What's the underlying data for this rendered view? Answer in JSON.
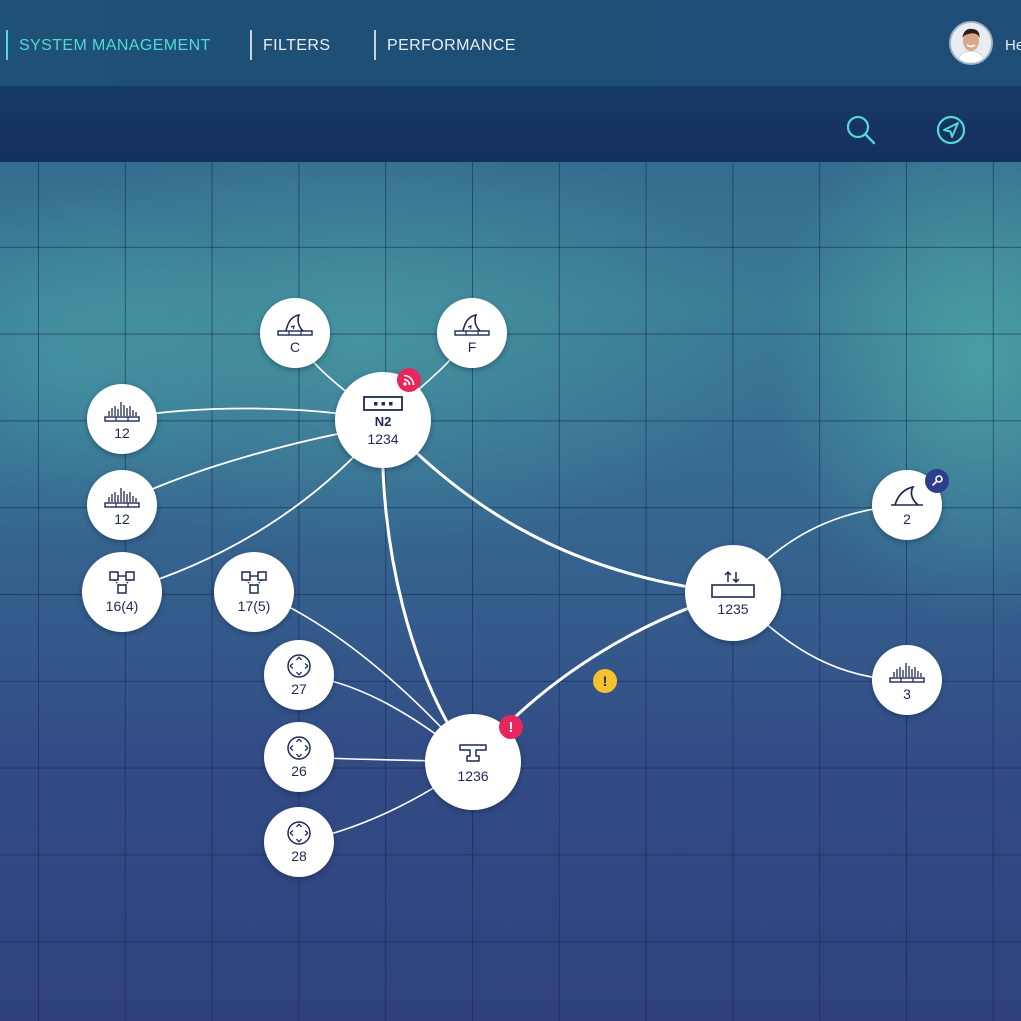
{
  "nav": {
    "items": [
      {
        "label": "SYSTEM MANAGEMENT",
        "active": true
      },
      {
        "label": "FILTERS",
        "active": false
      },
      {
        "label": "PERFORMANCE",
        "active": false
      }
    ],
    "user_name_partial": "He"
  },
  "toolbar": {
    "icons": [
      "search-icon",
      "send-icon"
    ]
  },
  "colors": {
    "accent": "#52d9d0",
    "alert_red": "#e8265e",
    "warning_yellow": "#f5c22f",
    "info_navy": "#2d3e8c",
    "node_text": "#1c2a55"
  },
  "topology": {
    "nodes": [
      {
        "id": "c",
        "icon": "shark-fin-icon",
        "label": "C"
      },
      {
        "id": "f",
        "icon": "shark-fin-icon",
        "label": "F"
      },
      {
        "id": "n2",
        "icon": "rack-device-icon",
        "title": "N2",
        "label": "1234",
        "badge": "wifi-alert"
      },
      {
        "id": "s12a",
        "icon": "signal-bars-icon",
        "label": "12"
      },
      {
        "id": "s12b",
        "icon": "signal-bars-icon",
        "label": "12"
      },
      {
        "id": "net16",
        "icon": "network-nodes-icon",
        "label": "16(4)"
      },
      {
        "id": "net17",
        "icon": "network-nodes-icon",
        "label": "17(5)"
      },
      {
        "id": "r27",
        "icon": "router-icon",
        "label": "27"
      },
      {
        "id": "r26",
        "icon": "router-icon",
        "label": "26"
      },
      {
        "id": "r28",
        "icon": "router-icon",
        "label": "28"
      },
      {
        "id": "t1236",
        "icon": "tap-icon",
        "label": "1236",
        "badge": "error"
      },
      {
        "id": "sw1235",
        "icon": "switch-updown-icon",
        "label": "1235"
      },
      {
        "id": "fin2",
        "icon": "shark-fin-icon",
        "label": "2",
        "badge": "key"
      },
      {
        "id": "s3",
        "icon": "signal-bars-icon",
        "label": "3"
      }
    ],
    "edges": [
      {
        "from": "c",
        "to": "n2"
      },
      {
        "from": "f",
        "to": "n2"
      },
      {
        "from": "s12a",
        "to": "n2"
      },
      {
        "from": "s12b",
        "to": "n2"
      },
      {
        "from": "net16",
        "to": "n2"
      },
      {
        "from": "n2",
        "to": "t1236"
      },
      {
        "from": "n2",
        "to": "sw1235"
      },
      {
        "from": "net17",
        "to": "t1236"
      },
      {
        "from": "r27",
        "to": "t1236"
      },
      {
        "from": "r26",
        "to": "t1236"
      },
      {
        "from": "r28",
        "to": "t1236"
      },
      {
        "from": "t1236",
        "to": "sw1235",
        "warning": true
      },
      {
        "from": "sw1235",
        "to": "fin2"
      },
      {
        "from": "sw1235",
        "to": "s3"
      }
    ],
    "badge_glyphs": {
      "error": "!",
      "warning": "!"
    }
  }
}
